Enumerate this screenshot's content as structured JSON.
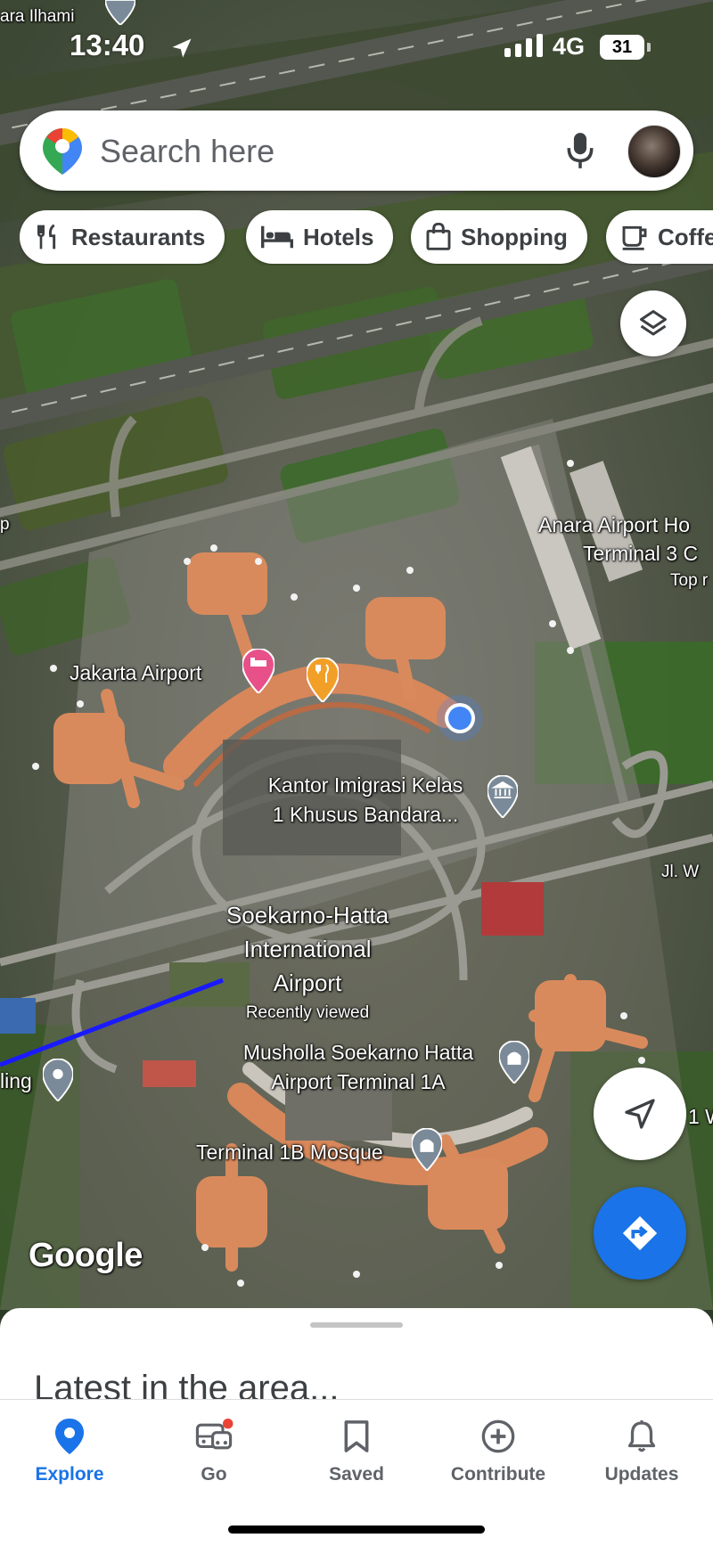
{
  "status_bar": {
    "time": "13:40",
    "network": "4G",
    "battery": "31"
  },
  "search": {
    "placeholder": "Search here"
  },
  "chips": [
    {
      "label": "Restaurants",
      "icon": "fork-knife-icon"
    },
    {
      "label": "Hotels",
      "icon": "bed-icon"
    },
    {
      "label": "Shopping",
      "icon": "shopping-bag-icon"
    },
    {
      "label": "Coffee",
      "icon": "coffee-cup-icon"
    }
  ],
  "map": {
    "labels": {
      "ara_ilhami": "ara Ilhami",
      "hotel_line1": "Anara Airport Ho",
      "hotel_line2": "Terminal 3 C",
      "top_rated": "Top r",
      "jakarta_airport": "Jakarta Airport",
      "kantor_line1": "Kantor Imigrasi Kelas",
      "kantor_line2": "1 Khusus Bandara...",
      "soekarno_line1": "Soekarno-Hatta",
      "soekarno_line2": "International",
      "soekarno_line3": "Airport",
      "recently_viewed": "Recently viewed",
      "musholla_line1": "Musholla Soekarno Hatta",
      "musholla_line2": "Airport Terminal 1A",
      "terminal_1b": "Terminal 1B Mosque",
      "jl": "Jl. W",
      "ling": "ling",
      "edge_p": "p",
      "edge_1w": "1 W"
    },
    "attribution": "Google"
  },
  "sheet": {
    "title": "Latest in the area..."
  },
  "nav": [
    {
      "label": "Explore",
      "icon": "explore-pin-icon",
      "active": true
    },
    {
      "label": "Go",
      "icon": "commute-icon",
      "active": false
    },
    {
      "label": "Saved",
      "icon": "bookmark-icon",
      "active": false
    },
    {
      "label": "Contribute",
      "icon": "add-circle-icon",
      "active": false
    },
    {
      "label": "Updates",
      "icon": "bell-icon",
      "active": false
    }
  ],
  "colors": {
    "accent": "#1a73e8",
    "hotel_pin": "#e8508a",
    "food_pin": "#f29f28",
    "gov_pin": "#7b8a99",
    "route": "#1a1aff"
  }
}
